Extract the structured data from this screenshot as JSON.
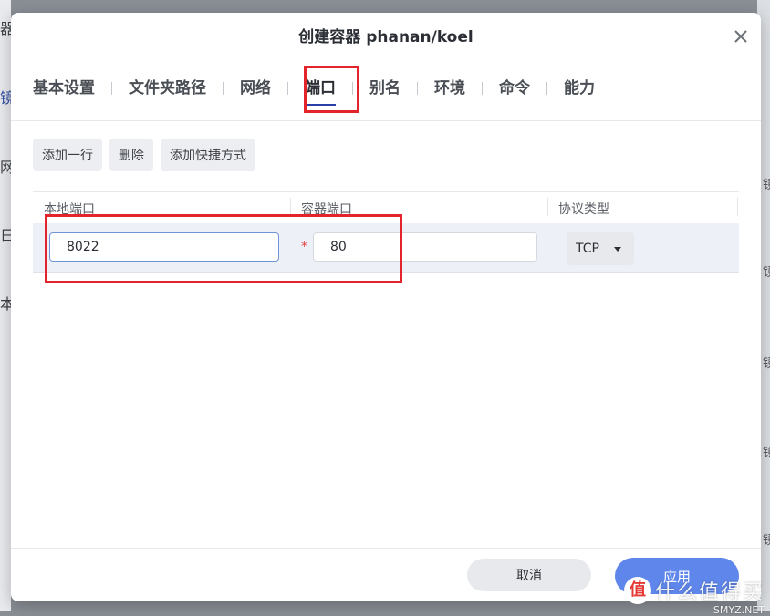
{
  "background": {
    "left_fragments": [
      "器",
      "镜",
      "网",
      "日",
      "本"
    ],
    "right_fragments": [
      "镜",
      "镜",
      "镜",
      "镜",
      "镜"
    ]
  },
  "dialog": {
    "title": "创建容器 phanan/koel",
    "tabs": [
      {
        "label": "基本设置",
        "active": false
      },
      {
        "label": "文件夹路径",
        "active": false
      },
      {
        "label": "网络",
        "active": false
      },
      {
        "label": "端口",
        "active": true
      },
      {
        "label": "别名",
        "active": false
      },
      {
        "label": "环境",
        "active": false
      },
      {
        "label": "命令",
        "active": false
      },
      {
        "label": "能力",
        "active": false
      }
    ],
    "toolbar": {
      "add_row": "添加一行",
      "delete": "删除",
      "add_shortcut": "添加快捷方式"
    },
    "table": {
      "headers": [
        "本地端口",
        "容器端口",
        "协议类型"
      ],
      "rows": [
        {
          "local_port": "8022",
          "required_mark": "*",
          "container_port": "80",
          "protocol": "TCP"
        }
      ]
    },
    "footer": {
      "cancel": "取消",
      "apply": "应用"
    }
  },
  "watermark": {
    "logo": "值",
    "text": "什么值得买",
    "site": "SMYZ.NET"
  },
  "colors": {
    "accent": "#2b3fa8",
    "apply_button": "#5f86ea",
    "annotation_red": "#e3242b",
    "required_red": "#e0413c"
  }
}
